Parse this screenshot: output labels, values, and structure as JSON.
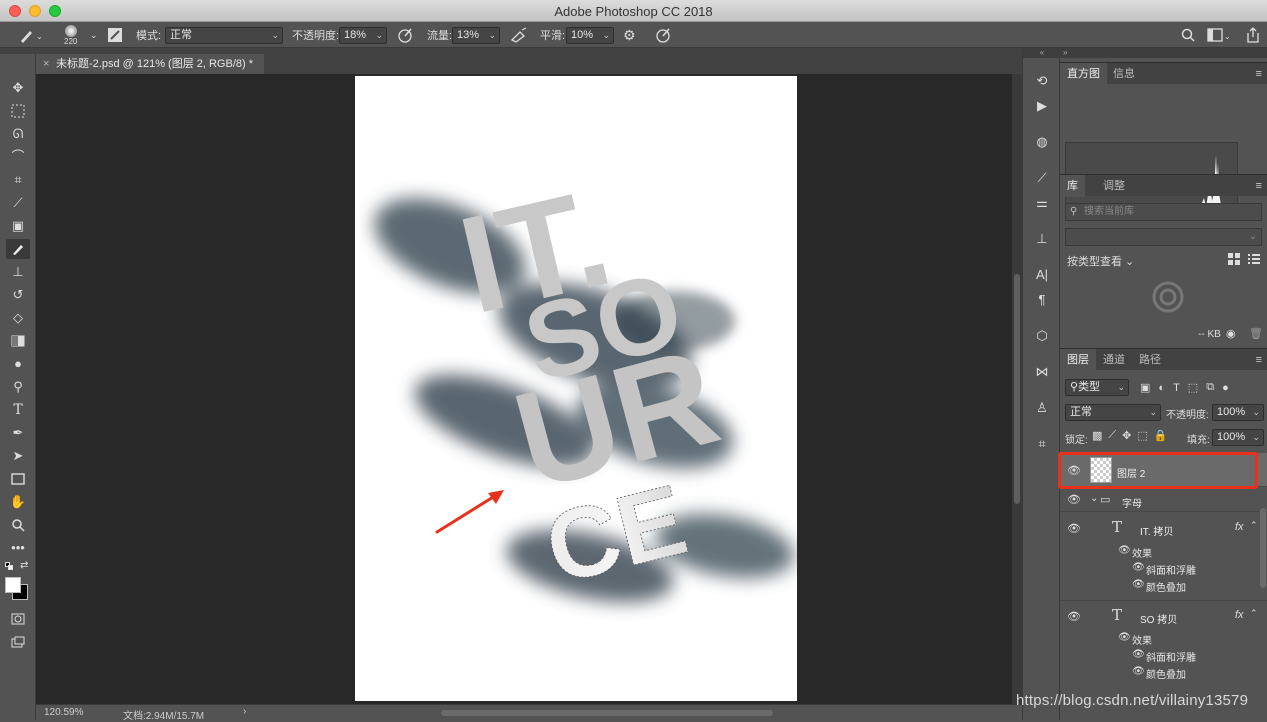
{
  "window": {
    "title": "Adobe Photoshop CC 2018"
  },
  "options_bar": {
    "brush_size": "220",
    "mode_label": "模式:",
    "mode_value": "正常",
    "opacity_label": "不透明度:",
    "opacity_value": "18%",
    "flow_label": "流量:",
    "flow_value": "13%",
    "smoothing_label": "平滑:",
    "smoothing_value": "10%"
  },
  "document": {
    "tab_title": "未标题-2.psd @ 121% (图层 2, RGB/8) *",
    "canvas_text": [
      "IT.",
      "SO",
      "UR",
      "CE"
    ]
  },
  "status": {
    "zoom": "120.59%",
    "doc_size": "文档:2.94M/15.7M"
  },
  "panels": {
    "histogram_tabs": [
      "直方图",
      "信息"
    ],
    "library_tabs": [
      "库",
      "调整"
    ],
    "library_search_placeholder": "搜索当前库",
    "view_by": "按类型查看",
    "library_size": "-- KB",
    "layers_tabs": [
      "图层",
      "通道",
      "路径"
    ],
    "filter_label": "类型",
    "blend_mode": "正常",
    "opacity_label": "不透明度:",
    "opacity_value": "100%",
    "lock_label": "锁定:",
    "fill_label": "填充:",
    "fill_value": "100%"
  },
  "layers": {
    "layer2": "图层 2",
    "group": "字母",
    "it_copy": "IT. 拷贝",
    "so_copy": "SO 拷贝",
    "effects": "效果",
    "bevel": "斜面和浮雕",
    "color_overlay": "颜色叠加",
    "fx": "fx"
  },
  "watermark": "https://blog.csdn.net/villainy13579",
  "colors": {
    "highlight": "#e8311b",
    "arrow": "#e8311b"
  }
}
